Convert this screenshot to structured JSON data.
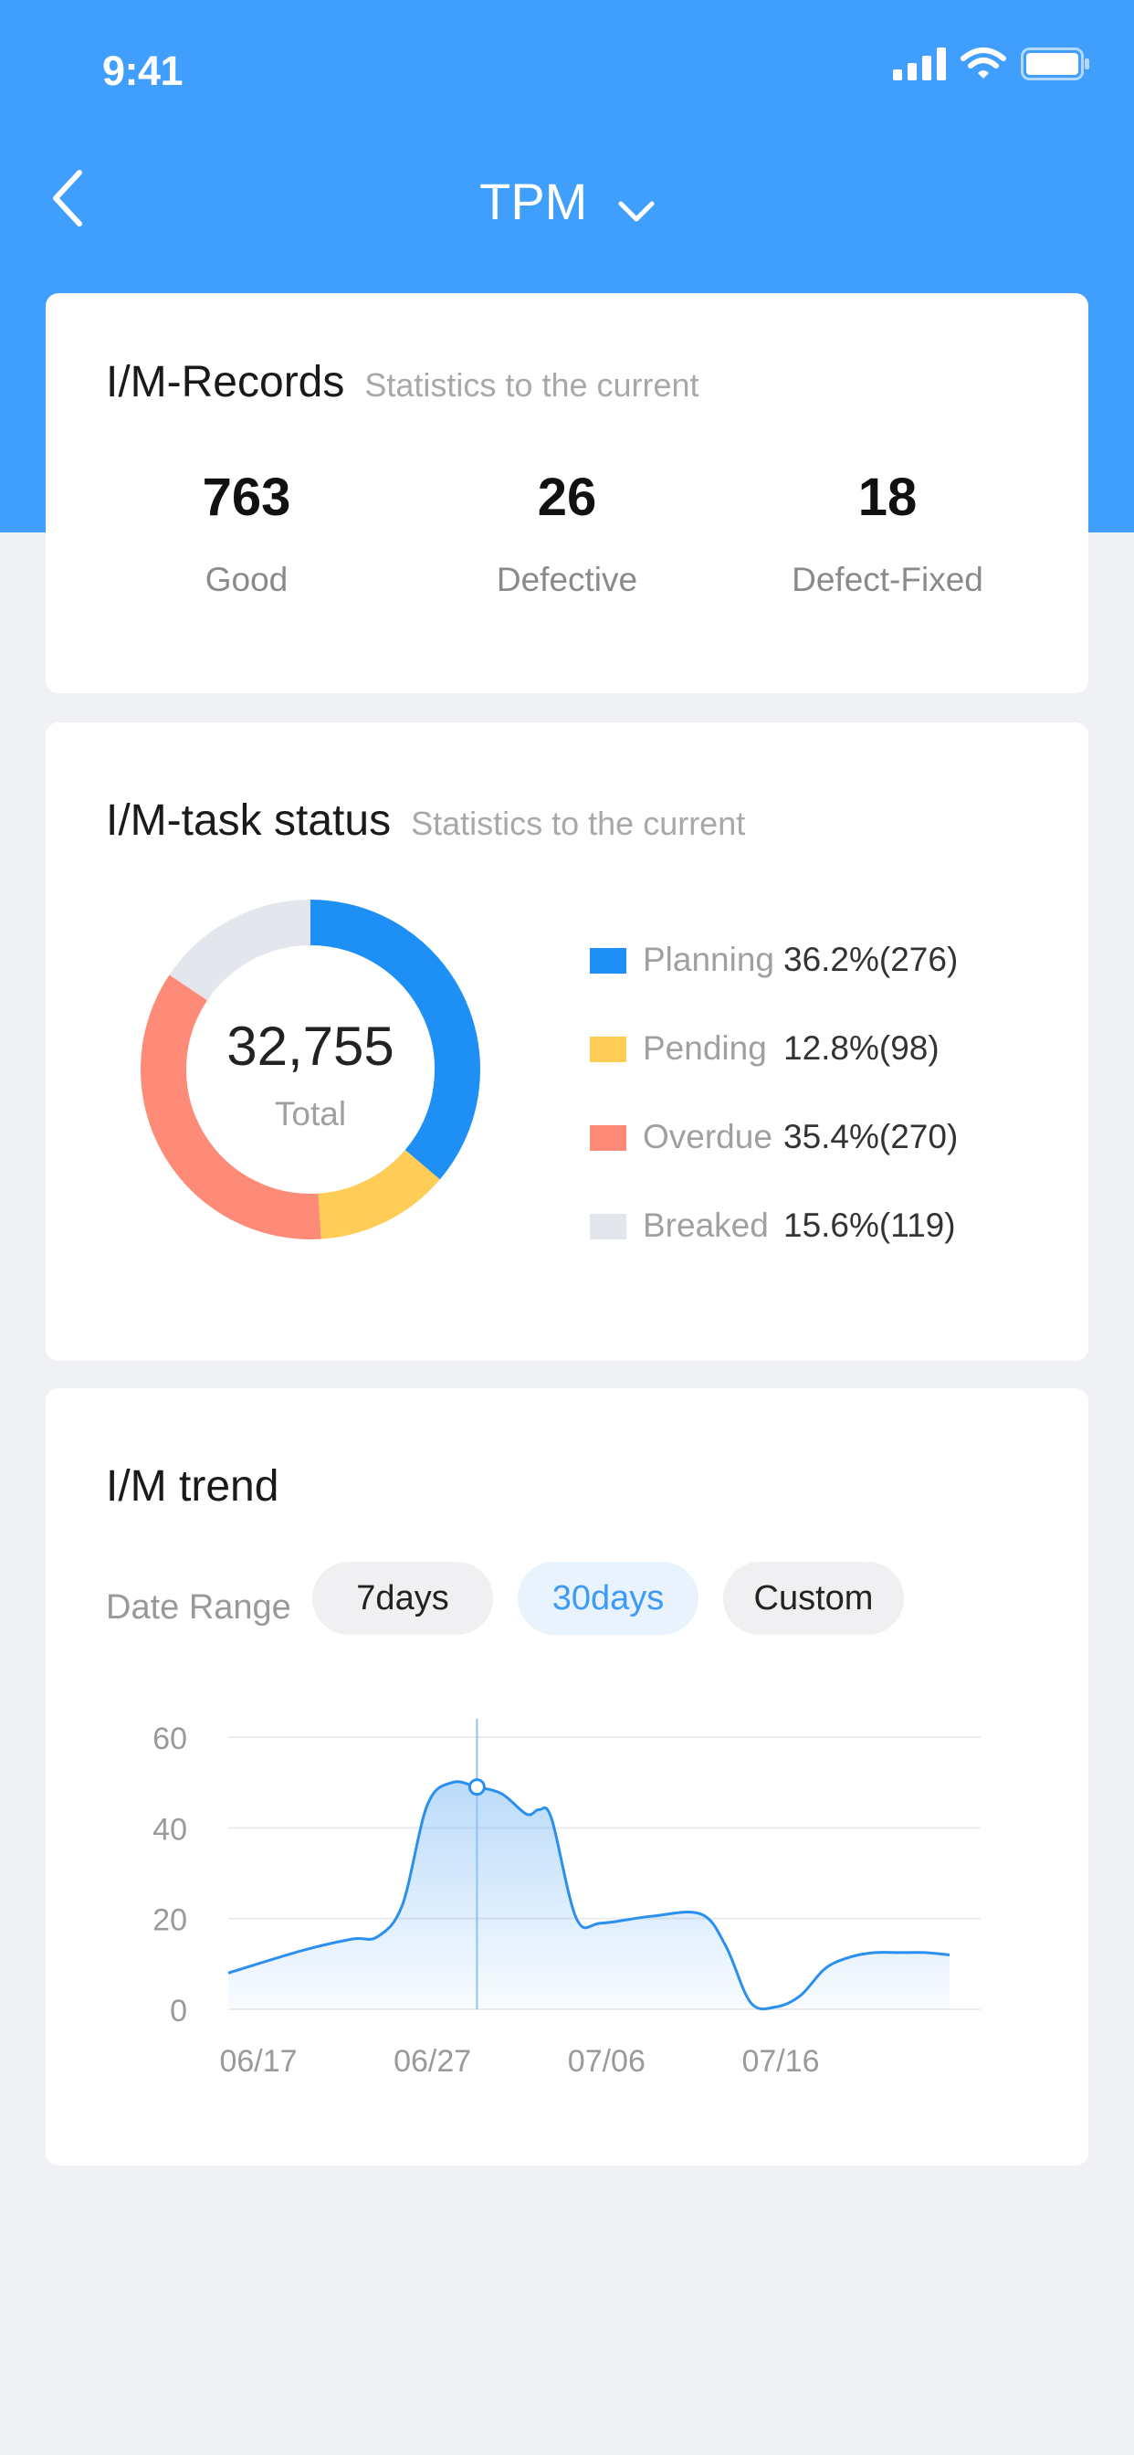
{
  "status_bar": {
    "time": "9:41"
  },
  "nav": {
    "title": "TPM"
  },
  "records": {
    "title": "I/M-Records",
    "subtitle": "Statistics to the current",
    "stats": [
      {
        "value": "763",
        "label": "Good"
      },
      {
        "value": "26",
        "label": "Defective"
      },
      {
        "value": "18",
        "label": "Defect-Fixed"
      }
    ]
  },
  "task_status": {
    "title": "I/M-task status",
    "subtitle": "Statistics to the current",
    "total_value": "32,755",
    "total_label": "Total",
    "legend": [
      {
        "name": "Planning",
        "value": "36.2%(276)",
        "percent": 36.2,
        "color": "#1e8ff5"
      },
      {
        "name": "Pending",
        "value": "12.8%(98)",
        "percent": 12.8,
        "color": "#ffcc55"
      },
      {
        "name": "Overdue",
        "value": "35.4%(270)",
        "percent": 35.4,
        "color": "#fe8a78"
      },
      {
        "name": "Breaked",
        "value": "15.6%(119)",
        "percent": 15.6,
        "color": "#e4e6ed"
      }
    ]
  },
  "trend": {
    "title": "I/M trend",
    "date_range_label": "Date Range",
    "ranges": [
      {
        "label": "7days",
        "active": false
      },
      {
        "label": "30days",
        "active": true
      },
      {
        "label": "Custom",
        "active": false
      }
    ]
  },
  "chart_data": {
    "type": "area",
    "x_tick_labels": [
      "06/17",
      "06/27",
      "07/06",
      "07/16"
    ],
    "y_ticks": [
      0,
      20,
      40,
      60
    ],
    "ylim": [
      0,
      60
    ],
    "grid": true,
    "line_color": "#2b8ff0",
    "highlight_point": {
      "x": 10,
      "y": 49
    },
    "x": [
      0,
      3,
      5,
      6,
      7,
      8,
      9,
      10,
      11,
      12,
      12.5,
      13,
      14,
      15,
      17,
      19,
      20,
      21,
      22,
      23,
      24,
      25,
      26,
      27,
      28,
      29
    ],
    "values": [
      8,
      13,
      15.5,
      16,
      23,
      45,
      50,
      49,
      47.5,
      43,
      44,
      42,
      20,
      19,
      20.5,
      21,
      14,
      1.5,
      0.5,
      3,
      9,
      11.5,
      12.5,
      12.5,
      12.5,
      12
    ]
  }
}
